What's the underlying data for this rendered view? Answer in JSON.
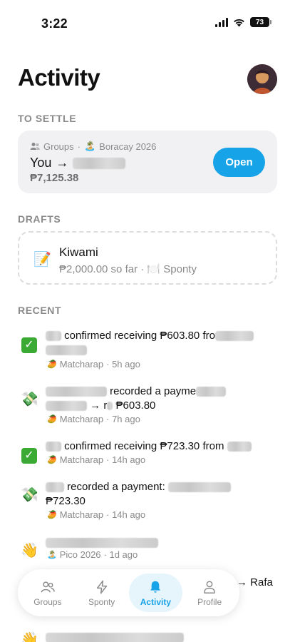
{
  "status_bar": {
    "time": "3:22",
    "battery": "73"
  },
  "header": {
    "title": "Activity"
  },
  "to_settle": {
    "label": "TO SETTLE",
    "meta_group": "Groups",
    "meta_sep": "·",
    "meta_trip_emoji": "🏝️",
    "meta_trip": "Boracay 2026",
    "title_you": "You",
    "arrow": "→",
    "amount": "₱7,125.38",
    "open_label": "Open"
  },
  "drafts": {
    "label": "DRAFTS",
    "icon": "📝",
    "title": "Kiwami",
    "subtitle": "₱2,000.00 so far · 🍽️ Sponty"
  },
  "recent": {
    "label": "RECENT",
    "items": [
      {
        "icon": "check",
        "line1": "confirmed receiving ₱603.80 fro",
        "group_emoji": "🥭",
        "group": "Matcharap",
        "time": "· 5h ago"
      },
      {
        "icon": "💸",
        "line1": "recorded a payme",
        "line2_arrow": "→ r",
        "amount": "₱603.80",
        "group_emoji": "🥭",
        "group": "Matcharap",
        "time": "· 7h ago"
      },
      {
        "icon": "check",
        "line1": "confirmed receiving ₱723.30 from",
        "group_emoji": "🥭",
        "group": "Matcharap",
        "time": "· 14h ago"
      },
      {
        "icon": "💸",
        "line1": "recorded a payment:",
        "amount": "₱723.30",
        "group_emoji": "🥭",
        "group": "Matcharap",
        "time": "· 14h ago"
      },
      {
        "icon": "👋",
        "group_emoji": "🏝️",
        "group": "Pico 2026",
        "time": "· 1d ago"
      }
    ],
    "overflow_text": "→ Rafa",
    "last_icon": "👋"
  },
  "nav": {
    "items": [
      {
        "label": "Groups",
        "icon": "groups-icon"
      },
      {
        "label": "Sponty",
        "icon": "bolt-icon"
      },
      {
        "label": "Activity",
        "icon": "bell-icon"
      },
      {
        "label": "Profile",
        "icon": "person-icon"
      }
    ],
    "active": "Activity",
    "accent": "#17a3e8"
  }
}
